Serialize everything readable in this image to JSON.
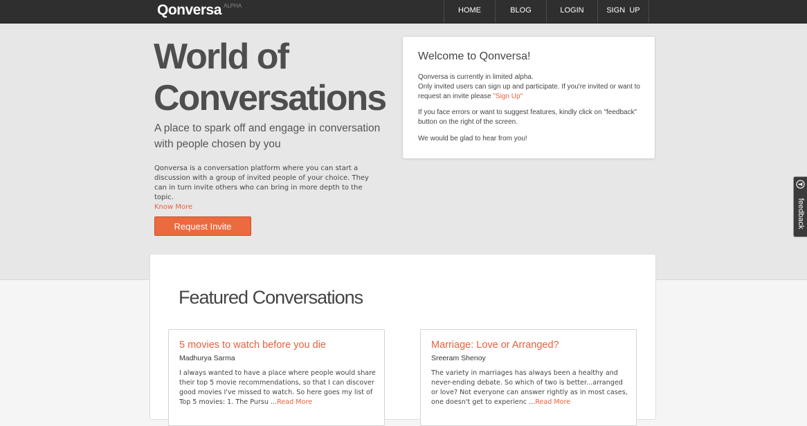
{
  "header": {
    "brand": "Qonversa",
    "brand_tag": "ALPHA",
    "nav": [
      {
        "label": "HOME"
      },
      {
        "label": "BLOG"
      },
      {
        "label": "LOGIN"
      },
      {
        "label": "SIGN  UP"
      }
    ]
  },
  "hero": {
    "title_line1": "World of",
    "title_line2": "Conversations",
    "subtitle": "A place to spark off and engage in conversation with people chosen by you",
    "description": "Qonversa is a conversation platform where you can start a discussion with a group of invited people of your choice. They can in turn invite others who can bring in more depth to the topic.",
    "know_more": "Know More",
    "invite_button": "Request Invite"
  },
  "welcome": {
    "title": "Welcome to Qonversa!",
    "p1_line1": "Qonversa is currently in limited alpha.",
    "p1_line2": "Only invited users can sign up and participate. If you're invited or want to request an invite please",
    "signup_link": "\"Sign Up\"",
    "p2": "If you face errors or want to suggest features, kindly click on \"feedback\" button on the right of the screen.",
    "p3": "We would be glad to hear from you!"
  },
  "feedback": {
    "label": "feedback",
    "icon": "megaphone-icon"
  },
  "featured": {
    "title": "Featured Conversations",
    "cards": [
      {
        "title": "5 movies to watch before you die",
        "author": "Madhurya Sarma",
        "excerpt": "I always wanted to have a place where people would share their top 5 movie recommendations, so that I can discover good movies I've missed to watch. So here goes my list of Top 5 movies: 1. The Pursu ...",
        "read_more": "Read More"
      },
      {
        "title": "Marriage: Love or Arranged?",
        "author": "Sreeram Shenoy",
        "excerpt": "The variety in marriages has always been a healthy and never-ending debate. So which of two is better...arranged or love? Not everyone can answer rightly as in most cases, one doesn't get to experienc ...",
        "read_more": "Read More"
      }
    ]
  },
  "colors": {
    "accent": "#ec6a3f",
    "topbar": "#2f2f2f",
    "hero_bg": "#e7e7e7"
  }
}
